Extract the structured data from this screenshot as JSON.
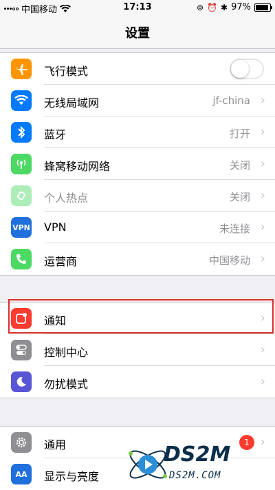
{
  "status": {
    "carrier": "中国移动",
    "time": "17:13",
    "battery": "97%",
    "battery_level": 0.97
  },
  "nav": {
    "title": "设置"
  },
  "group1": [
    {
      "name": "airplane",
      "label": "飞行模式",
      "icon": "airplane-icon",
      "color": "#ff9500",
      "toggle": false
    },
    {
      "name": "wifi",
      "label": "无线局域网",
      "value": "jf-china",
      "icon": "wifi-icon",
      "color": "#007aff"
    },
    {
      "name": "bluetooth",
      "label": "蓝牙",
      "value": "打开",
      "icon": "bluetooth-icon",
      "color": "#007aff"
    },
    {
      "name": "cellular",
      "label": "蜂窝移动网络",
      "value": "关闭",
      "icon": "cellular-icon",
      "color": "#4cd964"
    },
    {
      "name": "hotspot",
      "label": "个人热点",
      "value": "关闭",
      "icon": "hotspot-icon",
      "color": "#4cd964"
    },
    {
      "name": "vpn",
      "label": "VPN",
      "value": "未连接",
      "icon": "vpn-icon",
      "icon_text": "VPN",
      "color": "#1f6fdc"
    },
    {
      "name": "carrier",
      "label": "运营商",
      "value": "中国移动",
      "icon": "phone-icon",
      "color": "#4cd964"
    }
  ],
  "group2": [
    {
      "name": "notifications",
      "label": "通知",
      "icon": "notifications-icon",
      "color": "#ff3b30"
    },
    {
      "name": "control-center",
      "label": "控制中心",
      "icon": "control-center-icon",
      "color": "#8e8e93"
    },
    {
      "name": "do-not-disturb",
      "label": "勿扰模式",
      "icon": "moon-icon",
      "color": "#5856d6"
    }
  ],
  "group3": [
    {
      "name": "general",
      "label": "通用",
      "icon": "gear-icon",
      "color": "#8e8e93",
      "badge": "1"
    },
    {
      "name": "display",
      "label": "显示与亮度",
      "icon": "display-icon",
      "icon_text": "AA",
      "color": "#1f6fdc"
    }
  ],
  "watermark": {
    "main": "DS2M",
    "sub": "DS2M.COM"
  }
}
